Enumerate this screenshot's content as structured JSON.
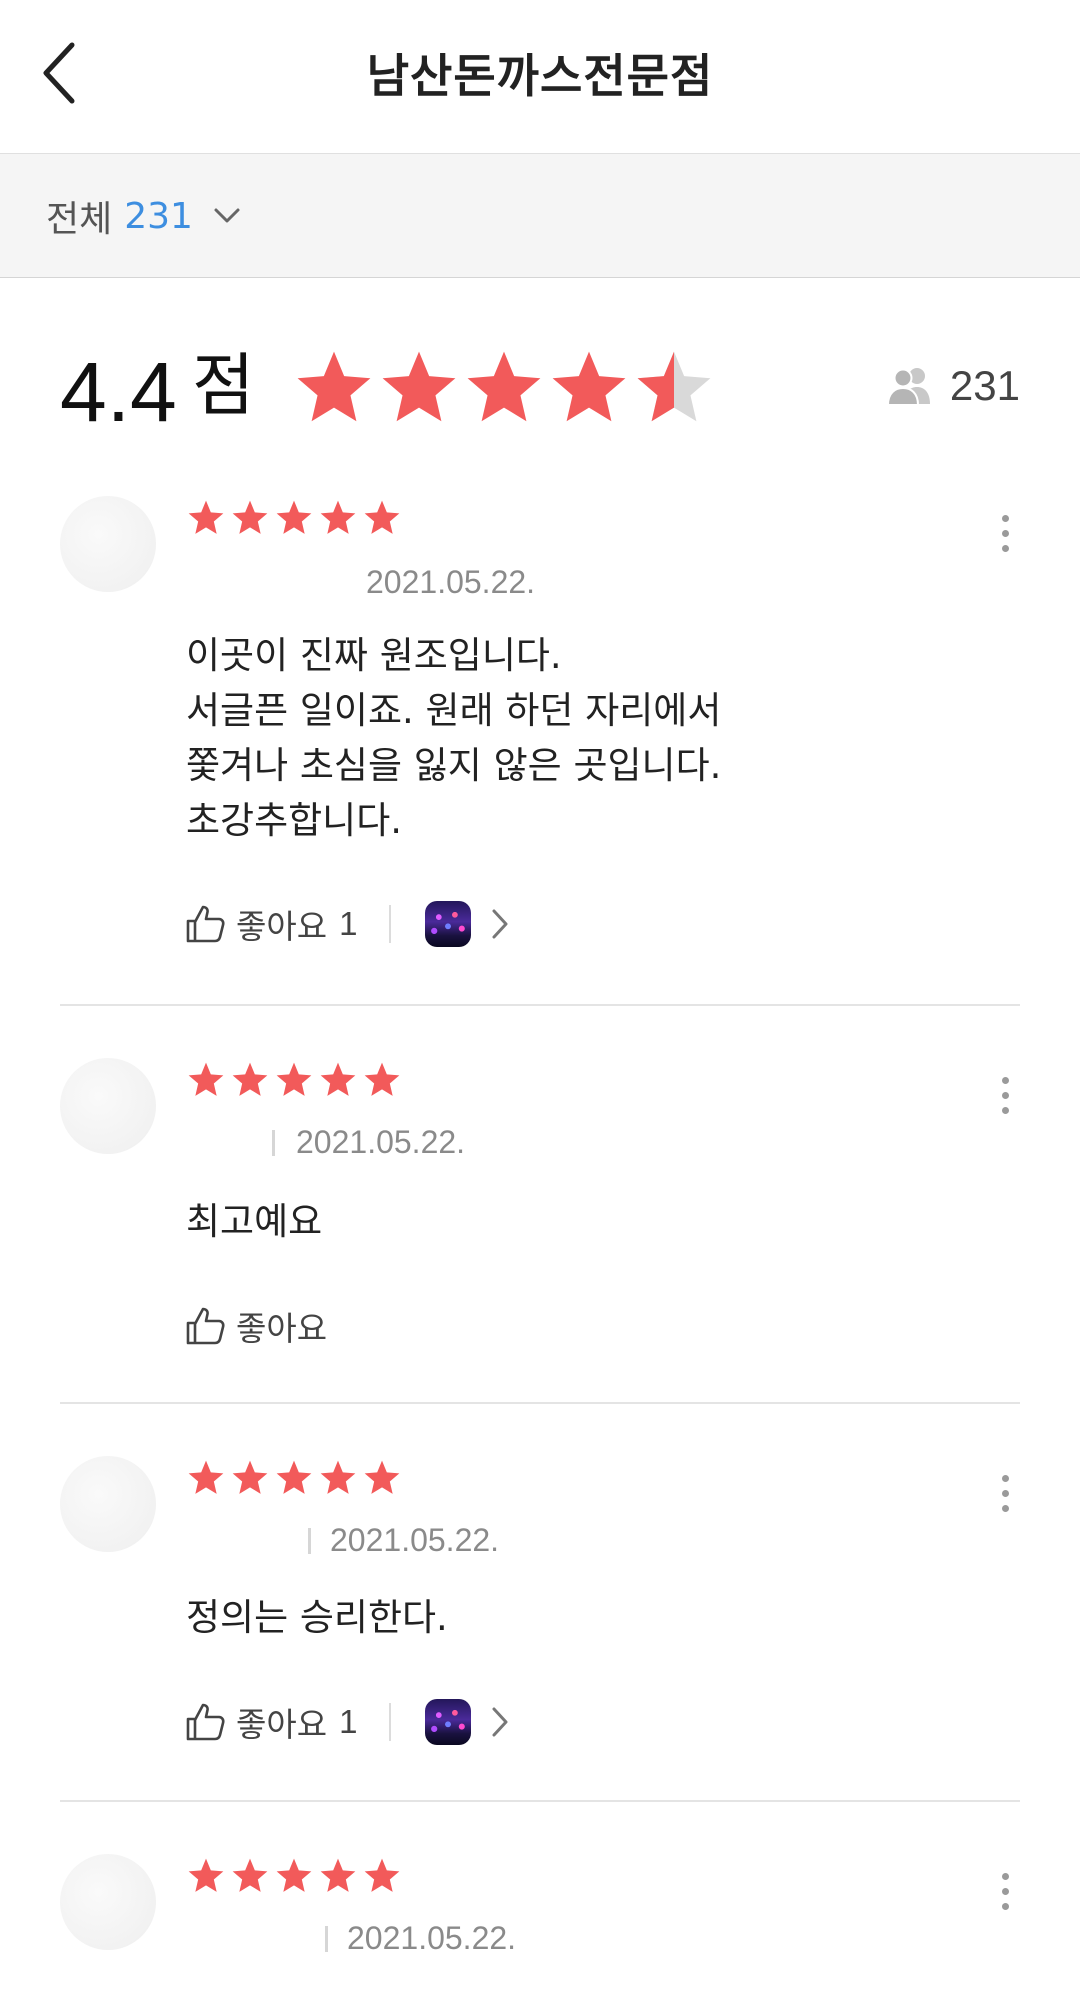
{
  "header": {
    "title": "남산돈까스전문점"
  },
  "filter": {
    "label": "전체",
    "count": "231"
  },
  "summary": {
    "score": "4.4",
    "unit": "점",
    "rating": 4.4,
    "rating_max": 5,
    "reviewer_count": "231"
  },
  "colors": {
    "star": "#f25a5a",
    "star_empty": "#d9d9d9",
    "accent": "#3d8ee0"
  },
  "icons": {
    "back": "chevron-left-icon",
    "filter": "chevron-down-icon",
    "people": "people-icon",
    "like": "thumbs-up-icon",
    "more": "more-vertical-icon",
    "next": "chevron-right-icon"
  },
  "reviews": [
    {
      "stars": 5,
      "date": "2021.05.22.",
      "text": [
        "이곳이 진짜 원조입니다.",
        "서글픈 일이죠. 원래 하던 자리에서",
        "쫓겨나 초심을 잃지 않은 곳입니다.",
        "초강추합니다."
      ],
      "like_label": "좋아요",
      "like_count": "1",
      "has_photo": true
    },
    {
      "stars": 5,
      "date": "2021.05.22.",
      "text": [
        "최고예요"
      ],
      "like_label": "좋아요",
      "like_count": "",
      "has_photo": false
    },
    {
      "stars": 5,
      "date": "2021.05.22.",
      "text": [
        "정의는 승리한다."
      ],
      "like_label": "좋아요",
      "like_count": "1",
      "has_photo": true
    },
    {
      "stars": 5,
      "date": "2021.05.22.",
      "text": [],
      "like_label": "",
      "like_count": "",
      "has_photo": false
    }
  ]
}
